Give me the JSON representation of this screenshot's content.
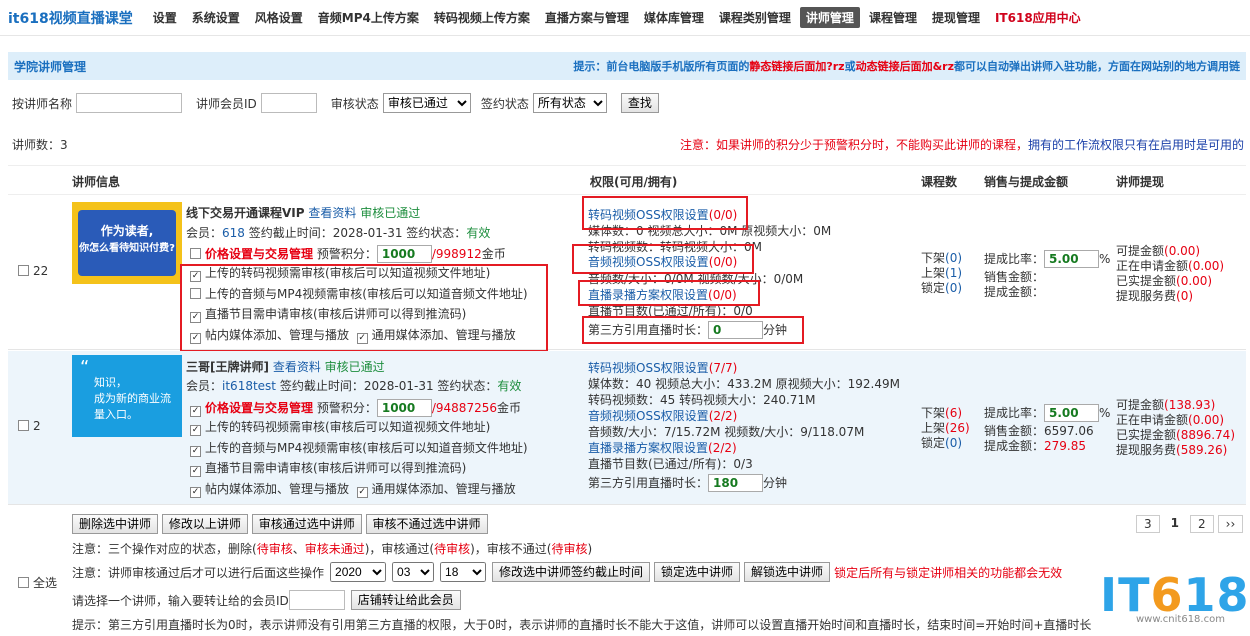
{
  "nav": {
    "brand": "it618视频直播课堂",
    "items": [
      "设置",
      "系统设置",
      "风格设置",
      "音频MP4上传方案",
      "转码视频上传方案",
      "直播方案与管理",
      "媒体库管理",
      "课程类别管理",
      "讲师管理",
      "课程管理",
      "提现管理"
    ],
    "app": "IT618应用中心"
  },
  "titlebar": {
    "title": "学院讲师管理",
    "hint_a": "提示：前台电脑版手机版所有页面的",
    "hint_b": "静态链接后面加?rz",
    "hint_c": "或",
    "hint_d": "动态链接后面加&rz",
    "hint_e": "都可以自动弹出讲师入驻功能，方面在网站别的地方调用链"
  },
  "search": {
    "name_label": "按讲师名称",
    "id_label": "讲师会员ID",
    "audit_label": "审核状态",
    "audit_value": "审核已通过",
    "contract_label": "签约状态",
    "contract_value": "所有状态",
    "button": "查找"
  },
  "count": {
    "text": "讲师数：3",
    "note_a": "注意：如果讲师的积分少于预警积分时，不能购买此讲师的课程，",
    "note_b": "拥有的工作流权限只有在启用时是可用的"
  },
  "thead": {
    "info": "讲师信息",
    "perm": "权限(可用/拥有)",
    "courses": "课程数",
    "sales": "销售与提成金额",
    "withdraw": "讲师提现"
  },
  "rows": [
    {
      "id": "22",
      "thumb_a": "作为读者,",
      "thumb_b": "你怎么看待知识付费?",
      "name": "线下交易开通课程VIP",
      "view": "查看资料",
      "status": "审核已通过",
      "member_label": "会员：",
      "member": "618",
      "expire": "签约截止时间：2028-01-31 签约状态：",
      "contract": "有效",
      "price_link": "价格设置与交易管理",
      "warn_label": "预警积分：",
      "warn": "1000",
      "points": "/998912",
      "points_unit": "金币",
      "c1": "上传的转码视频需审核(审核后可以知道视频文件地址)",
      "c2": "上传的音频与MP4视频需审核(审核后可以知道音频文件地址)",
      "c3": "直播节目需申请审核(审核后讲师可以得到推流码)",
      "c4": "帖内媒体添加、管理与播放",
      "c5": "通用媒体添加、管理与播放",
      "p1": "转码视频OSS权限设置",
      "p1n": "(0/0)",
      "p2": "媒体数：0 视频总大小：0M 原视频大小：0M",
      "p3": "转码视频数：转码视频大小：0M",
      "p4": "音频视频OSS权限设置",
      "p4n": "(0/0)",
      "p5": "音频数/大小：0/0M 视频数/大小：0/0M",
      "p6": "直播录播方案权限设置",
      "p6n": "(0/0)",
      "p7": "直播节目数(已通过/所有)：0/0",
      "p8": "第三方引用直播时长：",
      "p8v": "0",
      "p8u": "分钟",
      "xia": "下架",
      "xia_n": "(0)",
      "shang": "上架",
      "shang_n": "(1)",
      "suo": "锁定",
      "suo_n": "(0)",
      "rate_label": "提成比率：",
      "rate": "5.00",
      "rate_unit": "%",
      "sale_label": "销售金额：",
      "sale": "",
      "comm_label": "提成金额：",
      "comm": "",
      "w1": "可提金额",
      "w1n": "(0.00)",
      "w2": "正在申请金额",
      "w2n": "(0.00)",
      "w3": "已实提金额",
      "w3n": "(0.00)",
      "w4": "提现服务费",
      "w4n": "(0)"
    },
    {
      "id": "2",
      "thumb_a": "知识，",
      "thumb_b": "成为新的商业流量入口。",
      "name": "三哥[王牌讲师]",
      "view": "查看资料",
      "status": "审核已通过",
      "member_label": "会员：",
      "member": "it618test",
      "expire": "签约截止时间：2028-01-31 签约状态：",
      "contract": "有效",
      "price_link": "价格设置与交易管理",
      "warn_label": "预警积分：",
      "warn": "1000",
      "points": "/94887256",
      "points_unit": "金币",
      "c1": "上传的转码视频需审核(审核后可以知道视频文件地址)",
      "c2": "上传的音频与MP4视频需审核(审核后可以知道音频文件地址)",
      "c3": "直播节目需申请审核(审核后讲师可以得到推流码)",
      "c4": "帖内媒体添加、管理与播放",
      "c5": "通用媒体添加、管理与播放",
      "p1": "转码视频OSS权限设置",
      "p1n": "(7/7)",
      "p2": "媒体数：40 视频总大小：433.2M 原视频大小：192.49M",
      "p3": "转码视频数：45 转码视频大小：240.71M",
      "p4": "音频视频OSS权限设置",
      "p4n": "(2/2)",
      "p5": "音频数/大小：7/15.72M 视频数/大小：9/118.07M",
      "p6": "直播录播方案权限设置",
      "p6n": "(2/2)",
      "p7": "直播节目数(已通过/所有)：0/3",
      "p8": "第三方引用直播时长：",
      "p8v": "180",
      "p8u": "分钟",
      "xia": "下架",
      "xia_n": "(6)",
      "shang": "上架",
      "shang_n": "(26)",
      "suo": "锁定",
      "suo_n": "(0)",
      "rate_label": "提成比率：",
      "rate": "5.00",
      "rate_unit": "%",
      "sale_label": "销售金额：",
      "sale": "6597.06",
      "comm_label": "提成金额：",
      "comm": "279.85",
      "w1": "可提金额",
      "w1n": "(138.93)",
      "w2": "正在申请金额",
      "w2n": "(0.00)",
      "w3": "已实提金额",
      "w3n": "(8896.74)",
      "w4": "提现服务费",
      "w4n": "(589.26)"
    }
  ],
  "actions": {
    "b1": "删除选中讲师",
    "b2": "修改以上讲师",
    "b3": "审核通过选中讲师",
    "b4": "审核不通过选中讲师",
    "select_all": "全选",
    "note1_a": "注意：三个操作对应的状态，删除(",
    "note1_b": "待审核",
    "note1_c": "、",
    "note1_d": "审核未通过",
    "note1_e": ")，审核通过(",
    "note1_f": "待审核",
    "note1_g": ")，审核不通过(",
    "note1_h": "待审核",
    "note1_i": ")",
    "note2": "注意：讲师审核通过后才可以进行后面这些操作",
    "year": "2020",
    "month": "03",
    "day": "18",
    "b5": "修改选中讲师签约截止时间",
    "b6": "锁定选中讲师",
    "b7": "解锁选中讲师",
    "lock_note": "锁定后所有与锁定讲师相关的功能都会无效",
    "transfer_label": "请选择一个讲师，输入要转让给的会员ID",
    "b8": "店铺转让给此会员",
    "tip": "提示：第三方引用直播时长为0时，表示讲师没有引用第三方直播的权限，大于0时，表示讲师的直播时长不能大于这值，讲师可以设置直播开始时间和直播时长，结束时间=开始时间+直播时长"
  },
  "pager": {
    "p3": "3",
    "p1": "1",
    "p2": "2",
    "next": "››"
  },
  "logo": {
    "a": "IT",
    "b": "6",
    "c": "18",
    "sub": "www.cnit618.com"
  }
}
